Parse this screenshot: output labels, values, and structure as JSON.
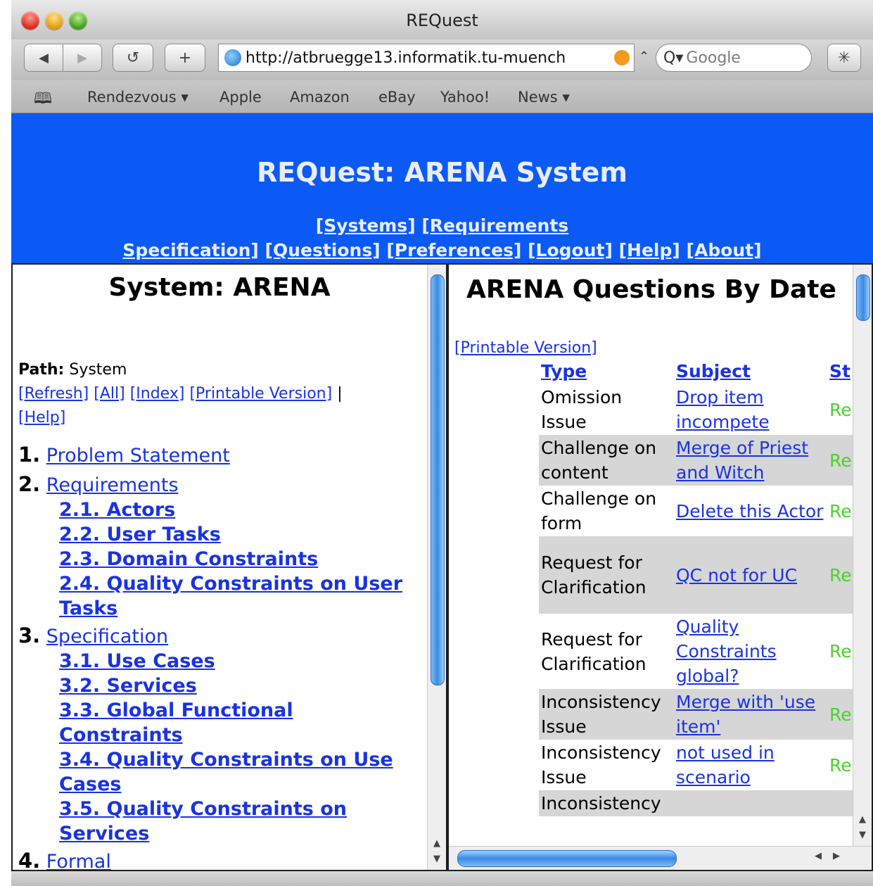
{
  "window": {
    "title": "REQuest"
  },
  "toolbar": {
    "url": "http://atbruegge13.informatik.tu-muench",
    "search_placeholder": "Google",
    "search_prefix": "Q▾",
    "back_glyph": "◀",
    "forward_glyph": "▶",
    "reload_glyph": "↺",
    "add_glyph": "+",
    "url_arrow_glyph": "⌃",
    "activity_glyph": "✳"
  },
  "bookmarks": {
    "book_glyph": "🕮",
    "items": [
      "Rendezvous ▾",
      "Apple",
      "Amazon",
      "eBay",
      "Yahoo!",
      "News ▾"
    ]
  },
  "header": {
    "title": "REQuest: ARENA System",
    "nav_line1": [
      "[Systems]",
      "[Requirements"
    ],
    "nav_line2": [
      "Specification]",
      "[Questions]",
      "[Preferences]",
      "[Logout]",
      "[Help]",
      "[About]"
    ]
  },
  "left": {
    "title": "System: ARENA",
    "path_label": "Path:",
    "path_value": "System",
    "links": [
      "[Refresh]",
      "[All]",
      "[Index]",
      "[Printable Version]"
    ],
    "separator": "|",
    "help_link": "[Help]",
    "toc": [
      {
        "num": "1.",
        "label": "Problem Statement",
        "children": []
      },
      {
        "num": "2.",
        "label": "Requirements",
        "children": [
          "2.1. Actors",
          "2.2. User Tasks",
          "2.3. Domain Constraints",
          "2.4. Quality Constraints on User Tasks"
        ]
      },
      {
        "num": "3.",
        "label": "Specification",
        "children": [
          "3.1. Use Cases",
          "3.2. Services",
          "3.3. Global Functional Constraints",
          "3.4. Quality Constraints on Use Cases",
          "3.5. Quality Constraints on Services"
        ]
      },
      {
        "num": "4.",
        "label": "Formal"
      }
    ]
  },
  "right": {
    "title": "ARENA Questions By Date",
    "printable": "[Printable Version]",
    "columns": [
      "Type",
      "Subject",
      "St"
    ],
    "rows": [
      {
        "type": "Omission Issue",
        "subject": "Drop item incompete",
        "status": "Re"
      },
      {
        "type": "Challenge on content",
        "subject": "Merge of Priest and Witch",
        "status": "Re"
      },
      {
        "type": "Challenge on form",
        "subject": "Delete this Actor",
        "status": "Re"
      },
      {
        "type": "Request for Clarification",
        "subject": "QC not for UC",
        "status": "Re"
      },
      {
        "type": "Request for Clarification",
        "subject": "Quality Constraints global?",
        "status": "Re"
      },
      {
        "type": "Inconsistency Issue",
        "subject": "Merge with 'use item'",
        "status": "Re"
      },
      {
        "type": "Inconsistency Issue",
        "subject": "not used in scenario",
        "status": "Re"
      },
      {
        "type": "Inconsistency",
        "subject": "",
        "status": ""
      }
    ]
  },
  "colors": {
    "header_bg": "#0b5af6",
    "link": "#1a33e0",
    "status_green": "#4bd12e",
    "row_shade": "#d6d6d6"
  }
}
